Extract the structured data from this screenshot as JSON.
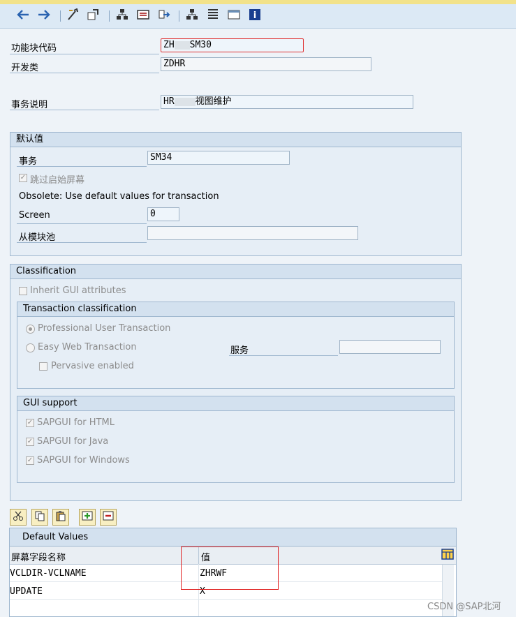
{
  "header": {
    "function_code_label": "功能块代码",
    "function_code_value_a": "ZH",
    "function_code_value_b": "SM30",
    "package_label": "开发类",
    "package_value": "ZDHR",
    "description_label": "事务说明",
    "description_value_a": "HR",
    "description_value_b": "视图维护"
  },
  "defaults_group": {
    "title": "默认值",
    "transaction_label": "事务",
    "transaction_value": "SM34",
    "skip_screen_label": "跳过启始屏幕",
    "obsolete_note": "Obsolete: Use default values for transaction",
    "screen_label": "Screen",
    "screen_value": "0",
    "module_pool_label": "从模块池",
    "module_pool_value": ""
  },
  "classification": {
    "title": "Classification",
    "inherit_gui_label": "Inherit GUI attributes",
    "transaction_classification": {
      "title": "Transaction classification",
      "professional_label": "Professional User Transaction",
      "easy_web_label": "Easy Web Transaction",
      "service_label": "服务",
      "service_value": "",
      "pervasive_label": "Pervasive enabled"
    },
    "gui_support": {
      "title": "GUI support",
      "html_label": "SAPGUI for HTML",
      "java_label": "SAPGUI for Java",
      "windows_label": "SAPGUI for Windows"
    }
  },
  "default_values_table": {
    "title": "Default Values",
    "col_field": "屏幕字段名称",
    "col_value": "值",
    "rows": [
      {
        "field": "VCLDIR-VCLNAME",
        "value": "ZHRWF"
      },
      {
        "field": "UPDATE",
        "value": "X"
      }
    ]
  },
  "watermark": "CSDN @SAP北河",
  "colors": {
    "accent": "#e02020",
    "panel": "#e6eef6",
    "toolbar": "#dce9f5"
  }
}
